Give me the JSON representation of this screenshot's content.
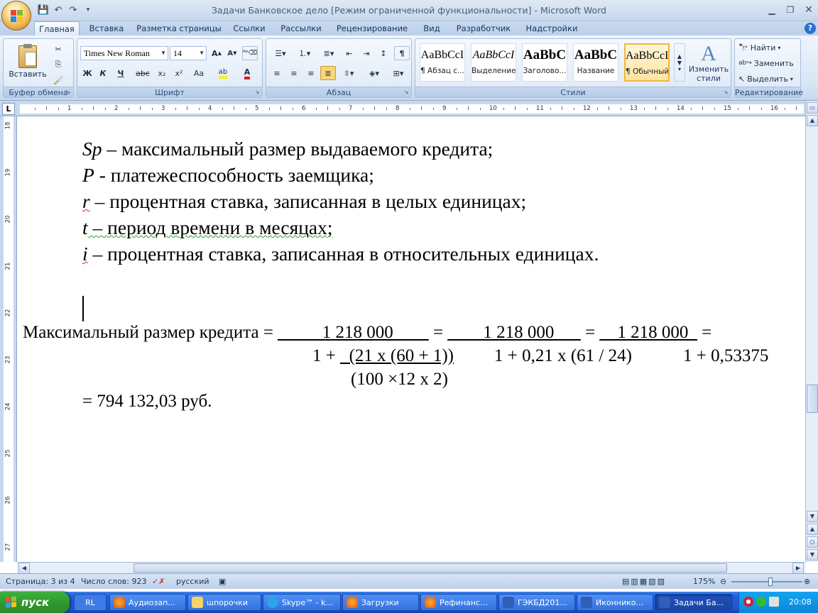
{
  "window": {
    "title": "Задачи Банковское дело [Режим ограниченной функциональности] - Microsoft Word"
  },
  "tabs": [
    "Главная",
    "Вставка",
    "Разметка страницы",
    "Ссылки",
    "Рассылки",
    "Рецензирование",
    "Вид",
    "Разработчик",
    "Надстройки"
  ],
  "ribbon": {
    "clipboard": {
      "paste_label": "Вставить",
      "group_label": "Буфер обмена"
    },
    "font": {
      "font_name": "Times New Roman",
      "font_size": "14",
      "group_label": "Шрифт",
      "bold": "Ж",
      "italic": "К",
      "underline": "Ч",
      "strike": "abc",
      "sub": "x₂",
      "sup": "x²",
      "case": "Aa"
    },
    "paragraph": {
      "group_label": "Абзац"
    },
    "styles": {
      "group_label": "Стили",
      "items": [
        {
          "sample": "AaBbCcI",
          "name": "¶ Абзац с..."
        },
        {
          "sample": "AaBbCcI",
          "name": "Выделение"
        },
        {
          "sample": "AaBbC",
          "name": "Заголово..."
        },
        {
          "sample": "AaBbC",
          "name": "Название"
        },
        {
          "sample": "AaBbCcI",
          "name": "¶ Обычный"
        }
      ],
      "change_styles_line1": "Изменить",
      "change_styles_line2": "стили"
    },
    "editing": {
      "group_label": "Редактирование",
      "find": "Найти",
      "replace": "Заменить",
      "select": "Выделить"
    }
  },
  "document": {
    "lines": [
      {
        "var": "Sp",
        "text": " – максимальный размер выдаваемого кредита;"
      },
      {
        "var": "P",
        "text": " - платежеспособность заемщика;"
      },
      {
        "var": "r",
        "text": " – процентная ставка, записанная в целых единицах;"
      },
      {
        "var": "t",
        "text": " – период времени в месяцах;"
      },
      {
        "var": "i",
        "text": " – процентная ставка, записанная в относительных единицах."
      }
    ],
    "formula": {
      "label": "Максимальный размер кредита = ",
      "num1": "_____1 218 000____",
      "eq1": " = ",
      "num2": "____1 218 000___",
      "eq2": " = ",
      "num3": "__1 218 000_",
      "eq3": " =",
      "den1a": "1 + ",
      "den1b": "_(21 x (60 + 1))",
      "den1c": "(100 ×12 x 2)",
      "den2": "1 + 0,21 x (61 / 24)",
      "den3": "1 + 0,53375",
      "result": "= 794 132,03 руб."
    }
  },
  "ruler_h": [
    "1",
    "2",
    "3",
    "4",
    "5",
    "6",
    "7",
    "8",
    "9",
    "10",
    "11",
    "12",
    "13",
    "14",
    "15",
    "16"
  ],
  "ruler_v": [
    "18",
    "19",
    "20",
    "21",
    "22",
    "23",
    "24",
    "25",
    "26",
    "27"
  ],
  "status": {
    "page": "Страница: 3 из 4",
    "words": "Число слов: 923",
    "language": "русский",
    "zoom": "175%"
  },
  "taskbar": {
    "start": "пуск",
    "lang": "RL",
    "items": [
      "Аудиозап...",
      "шпорочки",
      "Skype™ - k...",
      "Загрузки",
      "Рефинанс...",
      "ГЭКБД201...",
      "Иконнико...",
      "Задачи Ба..."
    ],
    "clock": "20:08"
  },
  "colors": {
    "ribbon": "#dbe7f5",
    "taskbar": "#245edb",
    "start": "#2f9a2f"
  }
}
